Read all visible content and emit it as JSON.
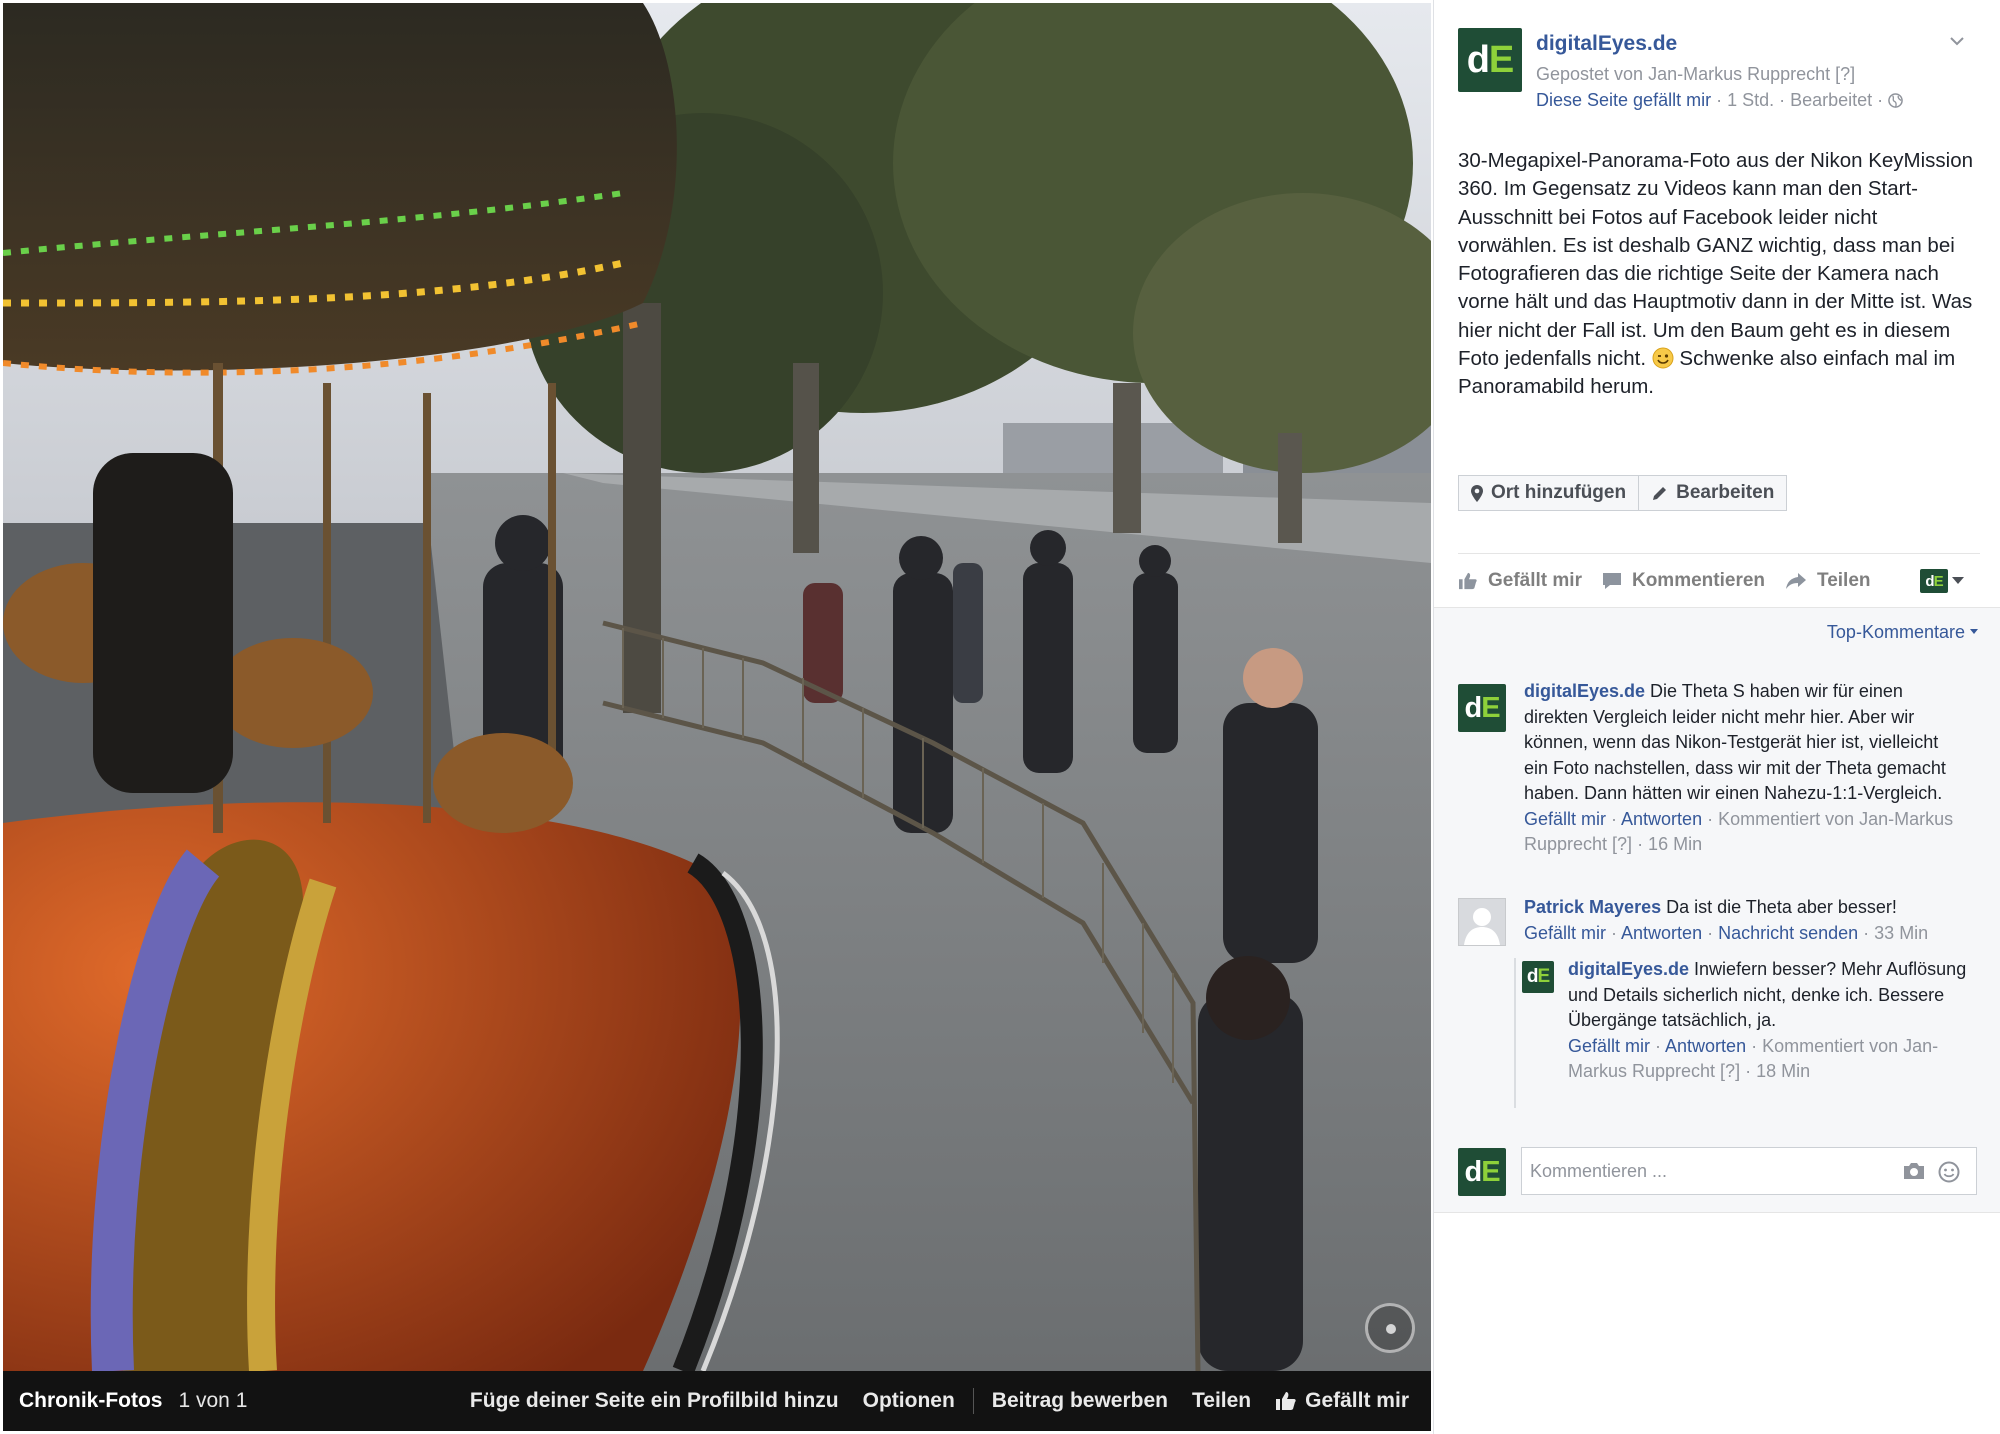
{
  "photo_bar": {
    "album": "Chronik-Fotos",
    "count": "1 von 1",
    "actions": [
      {
        "label": "Füge deiner Seite ein Profilbild hinzu"
      },
      {
        "label": "Optionen"
      },
      {
        "label": "Beitrag bewerben"
      },
      {
        "label": "Teilen"
      },
      {
        "label": "Gefällt mir"
      }
    ]
  },
  "post": {
    "page_name": "digitalEyes.de",
    "logo_text": {
      "d": "d",
      "e": "E"
    },
    "posted_by": "Gepostet von Jan-Markus Rupprecht [?]",
    "like_page": "Diese Seite gefällt mir",
    "meta": " · 1 Std. · Bearbeitet · ",
    "text_part1": "30-Megapixel-Panorama-Foto aus der Nikon KeyMission 360. Im Gegensatz zu Videos kann man den Start-Ausschnitt bei Fotos auf Facebook leider nicht vorwählen. Es ist deshalb GANZ wichtig, dass man bei Fotografieren das die richtige Seite der Kamera nach vorne hält und das Hauptmotiv dann in der Mitte ist. Was hier nicht der Fall ist. Um den Baum geht es in diesem Foto jedenfalls nicht.",
    "text_part2": " Schwenke also einfach mal im Panoramabild herum.",
    "buttons": {
      "add_location": "Ort hinzufügen",
      "edit": "Bearbeiten"
    },
    "actions": {
      "like": "Gefällt mir",
      "comment": "Kommentieren",
      "share": "Teilen"
    }
  },
  "comments": {
    "sort_label": "Top-Kommentare",
    "items": [
      {
        "author": "digitalEyes.de",
        "text": " Die Theta S haben wir für einen direkten Vergleich leider nicht mehr hier. Aber wir können, wenn das Nikon-Testgerät hier ist, vielleicht ein Foto nachstellen, dass wir mit der Theta gemacht haben. Dann hätten wir einen Nahezu-1:1-Vergleich.",
        "like": "Gefällt mir",
        "reply": "Antworten",
        "meta": " · Kommentiert von Jan-Markus Rupprecht [?] · 16 Min"
      },
      {
        "author": "Patrick Mayeres",
        "text": " Da ist die Theta aber besser!",
        "like": "Gefällt mir",
        "reply": "Antworten",
        "message": "Nachricht senden",
        "meta": " · 33 Min"
      },
      {
        "author": "digitalEyes.de",
        "text": " Inwiefern besser? Mehr Auflösung und Details sicherlich nicht, denke ich. Bessere Übergänge tatsächlich, ja.",
        "like": "Gefällt mir",
        "reply": "Antworten",
        "meta": " · Kommentiert von Jan-Markus Rupprecht [?] · 18 Min"
      }
    ],
    "input_placeholder": "Kommentieren ..."
  },
  "colors": {
    "link": "#365899",
    "muted": "#90949c",
    "logo_bg": "#1f4d36",
    "logo_accent": "#8ed13a",
    "photo_bar_bg": "#121212"
  },
  "icons": [
    "chevron-down-icon",
    "globe-icon",
    "pin-icon",
    "pencil-icon",
    "like-icon",
    "comment-icon",
    "share-icon",
    "camera-icon",
    "smiley-icon",
    "pan-360-icon"
  ]
}
